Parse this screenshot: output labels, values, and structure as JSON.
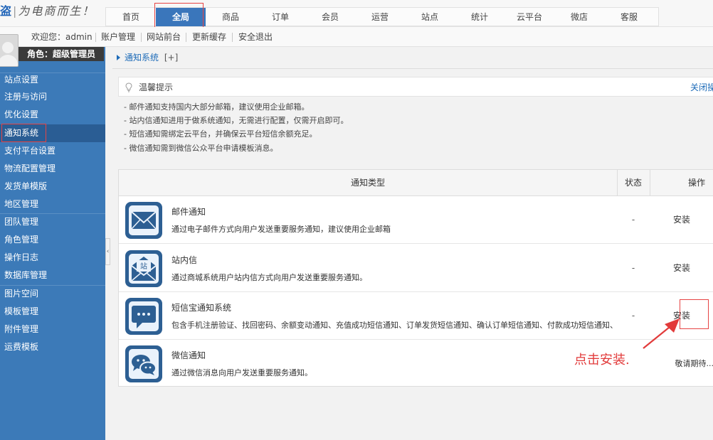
{
  "logo": {
    "brand": "盗",
    "slogan": "为电商而生！"
  },
  "topnav": [
    "首页",
    "全局",
    "商品",
    "订单",
    "会员",
    "运营",
    "站点",
    "统计",
    "云平台",
    "微店",
    "客服"
  ],
  "subbar": {
    "welcome": "欢迎您：admin",
    "links": [
      "账户管理",
      "网站前台",
      "更新缓存",
      "安全退出"
    ]
  },
  "sidebar": {
    "role": "角色：超级管理员",
    "items": [
      "站点设置",
      "注册与访问",
      "优化设置",
      "通知系统",
      "支付平台设置",
      "物流配置管理",
      "发货单模版",
      "地区管理",
      "团队管理",
      "角色管理",
      "操作日志",
      "数据库管理",
      "图片空间",
      "模板管理",
      "附件管理",
      "运费模板"
    ]
  },
  "breadcrumb": {
    "label": "通知系统",
    "plus": "[+]"
  },
  "tips": {
    "title": "温馨提示",
    "close": "关闭操作提示",
    "lines": [
      "- 邮件通知支持国内大部分邮箱，建议使用企业邮箱。",
      "- 站内信通知进用于做系统通知，无需进行配置，仅需开启即可。",
      "- 短信通知需绑定云平台，并确保云平台短信余额充足。",
      "- 微信通知需到微信公众平台申请模板消息。"
    ]
  },
  "table": {
    "headers": {
      "type": "通知类型",
      "status": "状态",
      "action": "操作"
    },
    "rows": [
      {
        "icon": "mail-icon",
        "title": "邮件通知",
        "desc": "通过电子邮件方式向用户发送重要服务通知，建议使用企业邮箱",
        "status": "-",
        "action": "安装"
      },
      {
        "icon": "station-mail-icon",
        "title": "站内信",
        "icon_text": "站",
        "desc": "通过商城系统用户站内信方式向用户发送重要服务通知。",
        "status": "-",
        "action": "安装"
      },
      {
        "icon": "sms-icon",
        "title": "短信宝通知系统",
        "desc": "包含手机注册验证、找回密码、余额变动通知、充值成功短信通知、订单发货短信通知、确认订单短信通知、付款成功短信通知、",
        "status": "-",
        "action": "安装"
      },
      {
        "icon": "wechat-icon",
        "title": "微信通知",
        "desc": "通过微信消息向用户发送重要服务通知。",
        "status": "",
        "action": "敬请期待..."
      }
    ]
  },
  "annotation": "点击安装.",
  "colors": {
    "sidebar": "#3c7ab8",
    "accent": "#1d6bb8",
    "highlight": "#e64444",
    "icon_bg": "#2d5f93"
  }
}
